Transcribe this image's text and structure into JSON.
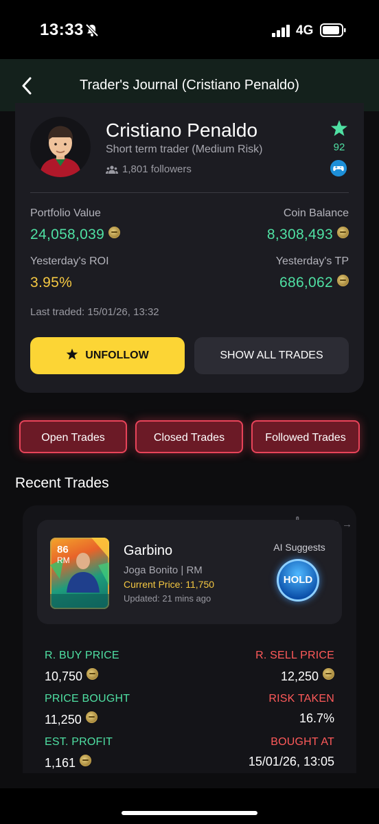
{
  "status_bar": {
    "time": "13:33",
    "network": "4G"
  },
  "nav": {
    "title": "Trader's Journal (Cristiano Penaldo)"
  },
  "profile": {
    "name": "Cristiano Penaldo",
    "subtitle": "Short term trader (Medium Risk)",
    "followers": "1,801 followers",
    "score": "92",
    "portfolio_label": "Portfolio Value",
    "portfolio_value": "24,058,039",
    "coin_label": "Coin Balance",
    "coin_value": "8,308,493",
    "roi_label": "Yesterday's ROI",
    "roi_value": "3.95%",
    "tp_label": "Yesterday's TP",
    "tp_value": "686,062",
    "last_traded": "Last traded: 15/01/26, 13:32",
    "unfollow_label": "UNFOLLOW",
    "show_all_label": "SHOW ALL TRADES"
  },
  "tabs": [
    "Open Trades",
    "Closed Trades",
    "Followed Trades"
  ],
  "recent": {
    "title": "Recent Trades",
    "charts_label": "Charts →",
    "player": {
      "rating": "86",
      "position": "RM",
      "name": "Garbino",
      "meta": "Joga Bonito | RM",
      "current_price": "Current Price: 11,750",
      "updated": "Updated: 21 mins ago"
    },
    "ai_label": "AI Suggests",
    "ai_action": "HOLD",
    "stats": {
      "r_buy_label": "R. BUY PRICE",
      "r_buy_value": "10,750",
      "r_sell_label": "R. SELL PRICE",
      "r_sell_value": "12,250",
      "bought_label": "PRICE BOUGHT",
      "bought_value": "11,250",
      "risk_label": "RISK TAKEN",
      "risk_value": "16.7%",
      "profit_label": "EST. PROFIT",
      "profit_value": "1,161",
      "bought_at_label": "BOUGHT AT",
      "bought_at_value": "15/01/26, 13:05"
    }
  },
  "colors": {
    "accent_green": "#4fe0a3",
    "accent_yellow": "#fcd535",
    "accent_red": "#ff5a5a",
    "nav_bg": "#14211c"
  }
}
